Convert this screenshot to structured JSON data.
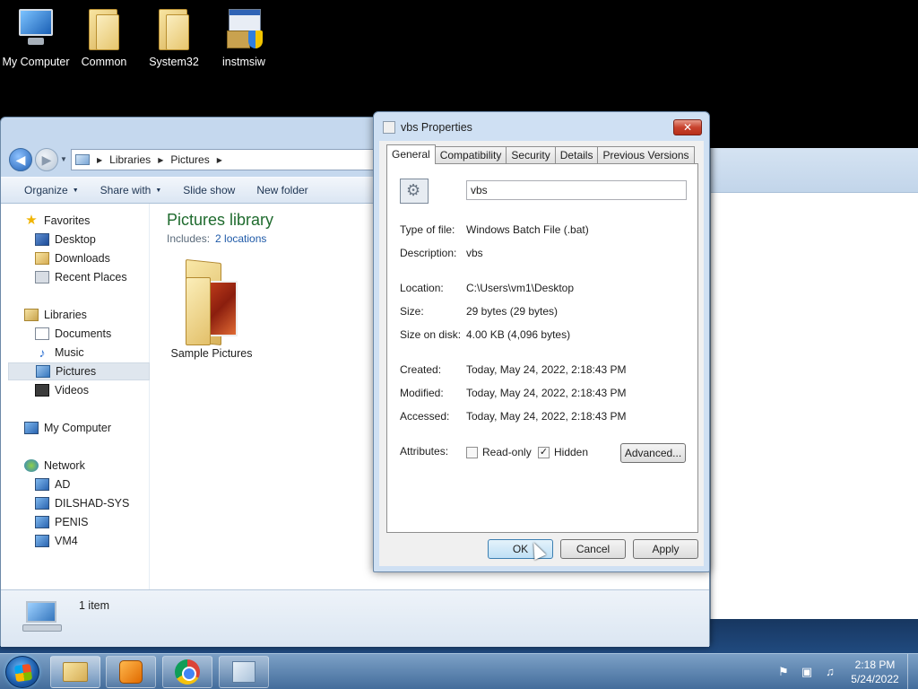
{
  "desktop": {
    "icons": [
      {
        "label": "My Computer"
      },
      {
        "label": "Common"
      },
      {
        "label": "System32"
      },
      {
        "label": "instmsiw"
      }
    ]
  },
  "explorer": {
    "breadcrumb": [
      "Libraries",
      "Pictures"
    ],
    "toolbar": {
      "organize": "Organize",
      "share_with": "Share with",
      "slide_show": "Slide show",
      "new_folder": "New folder"
    },
    "nav": {
      "favorites": "Favorites",
      "desktop": "Desktop",
      "downloads": "Downloads",
      "recent_places": "Recent Places",
      "libraries": "Libraries",
      "documents": "Documents",
      "music": "Music",
      "pictures": "Pictures",
      "videos": "Videos",
      "my_computer": "My Computer",
      "network": "Network",
      "net_ad": "AD",
      "net_dilshad": "DILSHAD-SYS",
      "net_penis": "PENIS",
      "net_vm4": "VM4"
    },
    "library_title": "Pictures library",
    "includes_label": "Includes:",
    "includes_link": "2 locations",
    "items": [
      {
        "label": "Sample Pictures"
      }
    ],
    "status_text": "1 item"
  },
  "dialog": {
    "title": "vbs Properties",
    "close_label": "✕",
    "tabs": [
      "General",
      "Compatibility",
      "Security",
      "Details",
      "Previous Versions"
    ],
    "active_tab": "General",
    "file_name": "vbs",
    "type_label": "Type of file:",
    "type_value": "Windows Batch File (.bat)",
    "desc_label": "Description:",
    "desc_value": "vbs",
    "location_label": "Location:",
    "location_value": "C:\\Users\\vm1\\Desktop",
    "size_label": "Size:",
    "size_value": "29 bytes (29 bytes)",
    "size_on_disk_label": "Size on disk:",
    "size_on_disk_value": "4.00 KB (4,096 bytes)",
    "created_label": "Created:",
    "created_value": "Today, May 24, 2022, 2:18:43 PM",
    "modified_label": "Modified:",
    "modified_value": "Today, May 24, 2022, 2:18:43 PM",
    "accessed_label": "Accessed:",
    "accessed_value": "Today, May 24, 2022, 2:18:43 PM",
    "attributes_label": "Attributes:",
    "readonly_label": "Read-only",
    "readonly_checked": false,
    "hidden_label": "Hidden",
    "hidden_checked": true,
    "advanced_label": "Advanced...",
    "ok_label": "OK",
    "cancel_label": "Cancel",
    "apply_label": "Apply"
  },
  "taskbar": {
    "time": "2:18 PM",
    "date": "5/24/2022"
  }
}
